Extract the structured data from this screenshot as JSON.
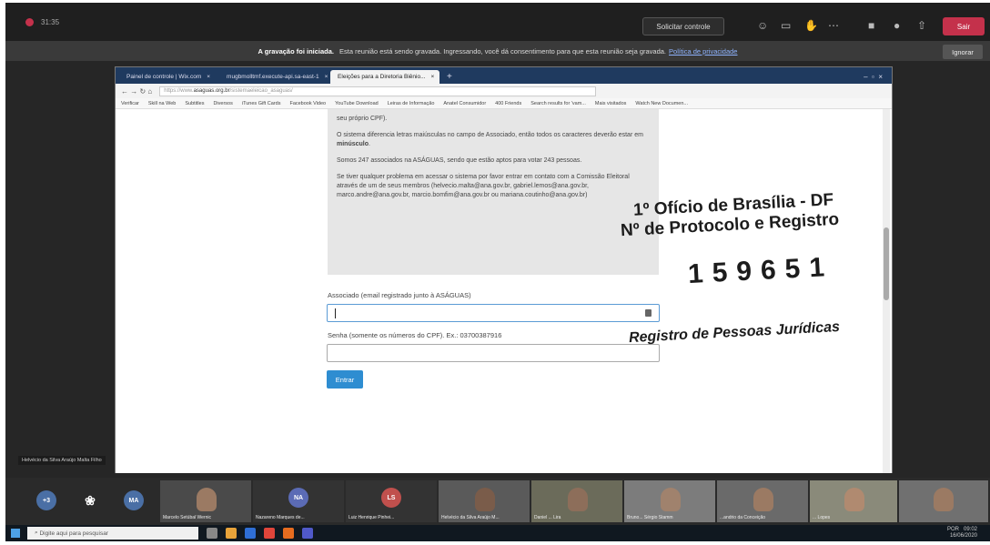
{
  "meeting": {
    "timer": "31:35",
    "request_control": "Solicitar controle",
    "leave": "Sair",
    "banner_bold": "A gravação foi iniciada.",
    "banner_text": "Esta reunião está sendo gravada. Ingressando, você dá consentimento para que esta reunião seja gravada.",
    "banner_link": "Política de privacidade",
    "ignore": "Ignorar",
    "speaker_name": "Helvécio da Silva Araújo Malta Filho"
  },
  "browser": {
    "tabs": [
      "Painel de controle | Wix.com",
      "mugbmolltmf.execute-api.sa-east-1",
      "Eleições para a Diretoria Biênio..."
    ],
    "url_prefix": "https://www.",
    "url_domain": "asaguas.org.br",
    "url_path": "/sistemaeleicao_asaguas/",
    "bookmarks": [
      "Verificar",
      "Skill na Web",
      "Subtitles",
      "Diversos",
      "iTunes Gift Cards",
      "Facebook Video",
      "YouTube Download",
      "Leiras de Informação",
      "Anatel Consumidor",
      "400 Friends",
      "Search results for 'vam...",
      "Mais visitados",
      "Watch New Documen..."
    ]
  },
  "page": {
    "info_paragraphs": [
      "seu próprio CPF).",
      "O sistema diferencia letras maiúsculas no campo de Associado, então todos os caracteres deverão estar em ",
      "Somos 247 associados na ASÁGUAS, sendo que estão aptos para votar 243 pessoas.",
      "Se tiver qualquer problema em acessar o sistema por favor entrar em contato com a Comissão Eleitoral através de um de seus membros (helvecio.malta@ana.gov.br, gabriel.lemos@ana.gov.br, marco.andre@ana.gov.br, marcio.bomfim@ana.gov.br ou mariana.coutinho@ana.gov.br)"
    ],
    "minusculo": "minúsculo",
    "associado_label": "Associado (email registrado junto à ASÁGUAS)",
    "senha_label": "Senha (somente os números do CPF). Ex.: 03700387916",
    "submit": "Entrar"
  },
  "stamp": {
    "line1": "1º Ofício de Brasília - DF",
    "line2": "Nº de Protocolo e Registro",
    "number": "159651",
    "line3": "Registro de Pessoas Jurídicas"
  },
  "participants": {
    "overflow": "+3",
    "initials_ma": "MA",
    "initials_na": "NA",
    "initials_ls": "LS",
    "names": [
      "Marcelo Setúbal Wernic",
      "Nazareno Marques de...",
      "Luiz Henrique Pinhei...",
      "Helvécio da Silva Araújo M...",
      "Daniel ... Lira",
      "Bruno... Sérgio Stamm",
      "...andrio da Conceição",
      "... Lopes"
    ]
  },
  "taskbar": {
    "search": "Digite aqui para pesquisar",
    "lang": "POR",
    "time": "09:02",
    "date": "16/06/2020"
  },
  "colors": {
    "accent": "#2e8dd1",
    "leave": "#c4314b",
    "tab_bar": "#1f3a5f"
  }
}
